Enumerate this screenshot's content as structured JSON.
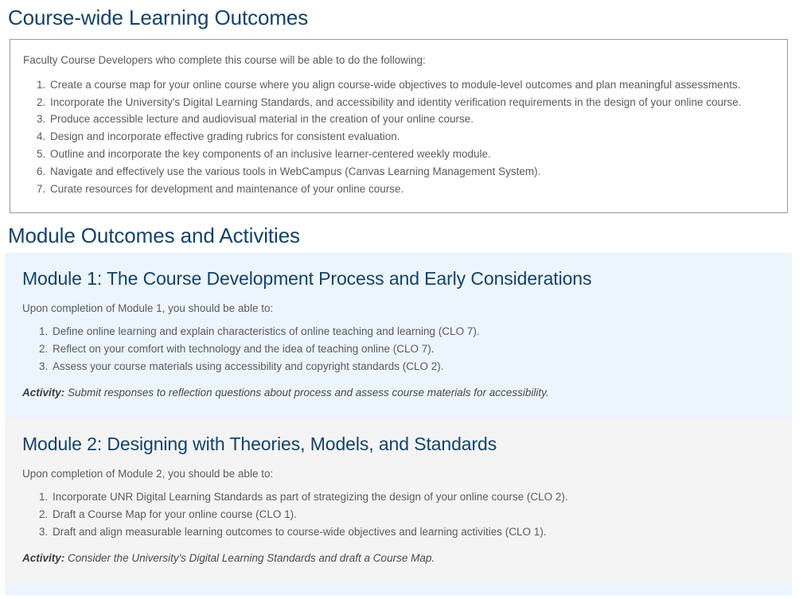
{
  "page": {
    "course_outcomes": {
      "title": "Course-wide Learning Outcomes",
      "intro": "Faculty Course Developers who complete this course will be able to do the following:",
      "items": [
        "Create a course map for your online course where you align course-wide objectives to module-level outcomes and plan meaningful assessments.",
        "Incorporate the University's Digital Learning Standards, and accessibility and identity verification requirements in the design of your online course.",
        "Produce accessible lecture and audiovisual material in the creation of your online course.",
        "Design and incorporate effective grading rubrics for consistent evaluation.",
        "Outline and incorporate the key components of an inclusive learner-centered weekly module.",
        "Navigate and effectively use the various tools in WebCampus (Canvas Learning Management System).",
        "Curate resources for development and maintenance of your online course."
      ]
    },
    "module_section": {
      "title": "Module Outcomes and Activities",
      "activity_label": "Activity:",
      "modules": [
        {
          "heading": "Module 1: The Course Development Process and Early Considerations",
          "lead": "Upon completion of Module 1, you should be able to:",
          "outcomes": [
            "Define online learning and explain characteristics of online teaching and learning (CLO 7).",
            "Reflect on your comfort with technology and the idea of teaching online (CLO 7).",
            "Assess your course materials using accessibility and copyright standards (CLO 2)."
          ],
          "activity": "Submit responses to reflection questions about process and assess course materials for accessibility.",
          "background": "#ecf4fd"
        },
        {
          "heading": "Module 2: Designing with Theories, Models, and Standards",
          "lead": "Upon completion of Module 2, you should be able to:",
          "outcomes": [
            "Incorporate UNR Digital Learning Standards as part of strategizing the design of your online course (CLO 2).",
            "Draft a Course Map for your online course (CLO 1).",
            "Draft and align measurable learning outcomes to course-wide objectives and learning activities (CLO 1)."
          ],
          "activity": "Consider the University's Digital Learning Standards and draft a Course Map.",
          "background": "#f4f4f4"
        }
      ]
    },
    "colors": {
      "heading": "#12426c",
      "body_text": "#5b5b5b",
      "box_border": "#9a9a9a",
      "module_blue": "#ecf4fd",
      "module_gray": "#f4f4f4"
    }
  }
}
